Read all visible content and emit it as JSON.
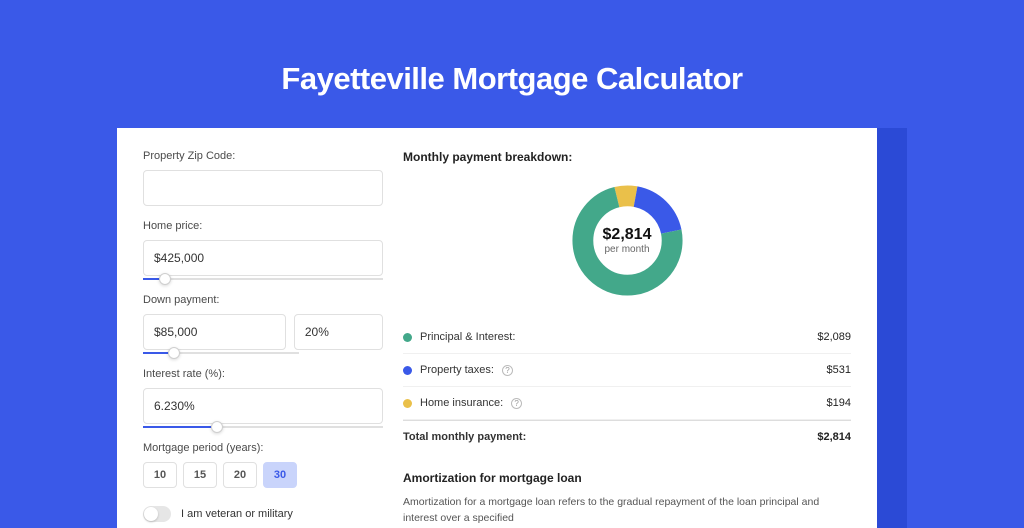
{
  "page_title": "Fayetteville Mortgage Calculator",
  "inputs": {
    "zip_label": "Property Zip Code:",
    "zip_value": "",
    "home_price_label": "Home price:",
    "home_price_value": "$425,000",
    "home_price_slider_pct": 9,
    "down_payment_label": "Down payment:",
    "down_payment_value": "$85,000",
    "down_payment_pct_value": "20%",
    "down_payment_slider_pct": 20,
    "interest_label": "Interest rate (%):",
    "interest_value": "6.230%",
    "interest_slider_pct": 31,
    "period_label": "Mortgage period (years):",
    "period_options": [
      "10",
      "15",
      "20",
      "30"
    ],
    "period_selected": "30",
    "veteran_label": "I am veteran or military",
    "veteran_on": false
  },
  "breakdown": {
    "title": "Monthly payment breakdown:",
    "donut_value": "$2,814",
    "donut_sub": "per month",
    "items": [
      {
        "label": "Principal & Interest:",
        "amount": "$2,089",
        "color": "#43a88a",
        "info": false
      },
      {
        "label": "Property taxes:",
        "amount": "$531",
        "color": "#3a59e8",
        "info": true
      },
      {
        "label": "Home insurance:",
        "amount": "$194",
        "color": "#eac04a",
        "info": true
      }
    ],
    "total_label": "Total monthly payment:",
    "total_amount": "$2,814"
  },
  "amortization": {
    "title": "Amortization for mortgage loan",
    "text": "Amortization for a mortgage loan refers to the gradual repayment of the loan principal and interest over a specified"
  },
  "chart_data": {
    "type": "pie",
    "title": "Monthly payment breakdown",
    "series": [
      {
        "name": "Principal & Interest",
        "value": 2089,
        "color": "#43a88a"
      },
      {
        "name": "Property taxes",
        "value": 531,
        "color": "#3a59e8"
      },
      {
        "name": "Home insurance",
        "value": 194,
        "color": "#eac04a"
      }
    ],
    "total": 2814,
    "center_label": "$2,814 per month"
  }
}
